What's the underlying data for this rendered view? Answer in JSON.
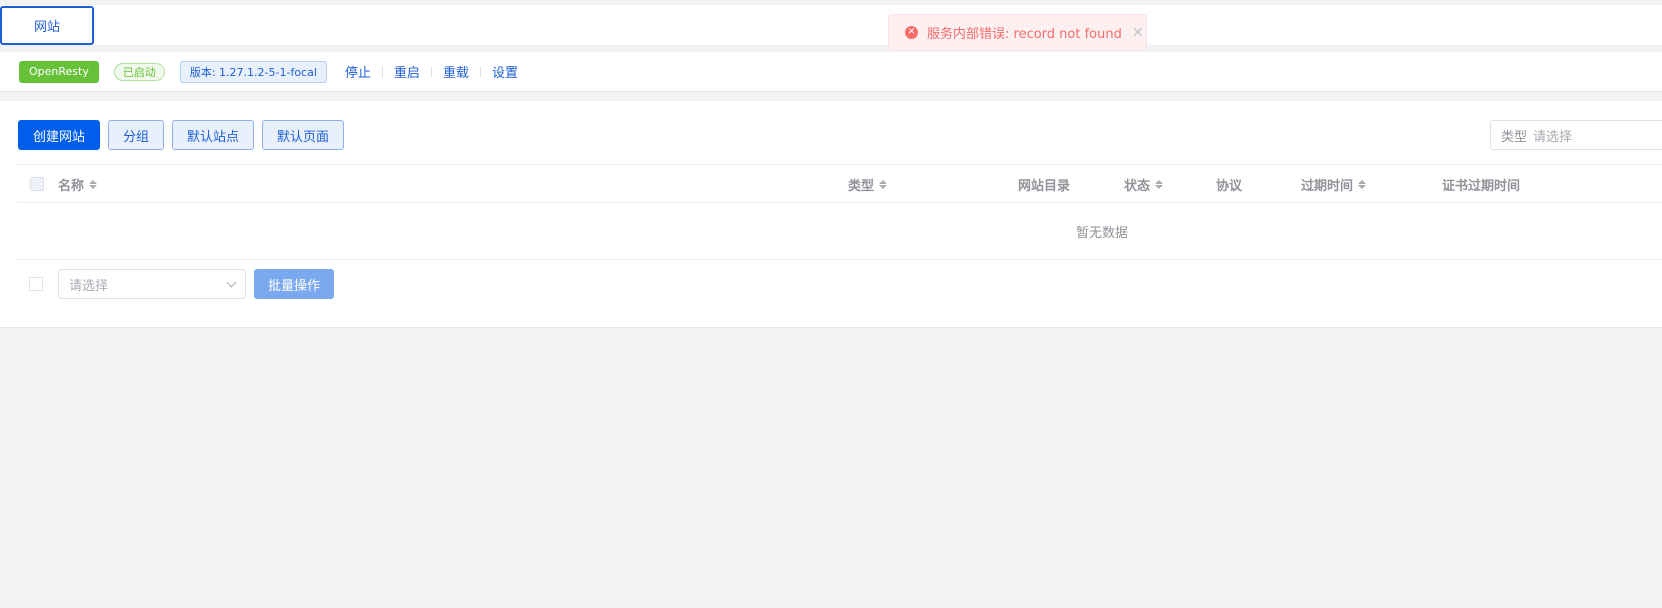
{
  "tabs": {
    "active": "网站"
  },
  "status_bar": {
    "app_name": "OpenResty",
    "status": "已启动",
    "version": "版本: 1.27.1.2-5-1-focal",
    "actions": [
      "停止",
      "重启",
      "重载",
      "设置"
    ]
  },
  "toolbar": {
    "create": "创建网站",
    "group": "分组",
    "default_site": "默认站点",
    "default_page": "默认页面"
  },
  "filter": {
    "label": "类型",
    "placeholder": "请选择"
  },
  "table": {
    "columns": {
      "name": "名称",
      "type": "类型",
      "dir": "网站目录",
      "status": "状态",
      "protocol": "协议",
      "expire": "过期时间",
      "cert_expire": "证书过期时间"
    },
    "empty_text": "暂无数据"
  },
  "footer": {
    "select_placeholder": "请选择",
    "batch_button": "批量操作"
  },
  "toast": {
    "message": "服务内部错误: record not found",
    "icon": "error-circle-icon"
  },
  "colors": {
    "primary": "#005eeb",
    "success": "#67c23a",
    "error": "#f56c6c"
  }
}
